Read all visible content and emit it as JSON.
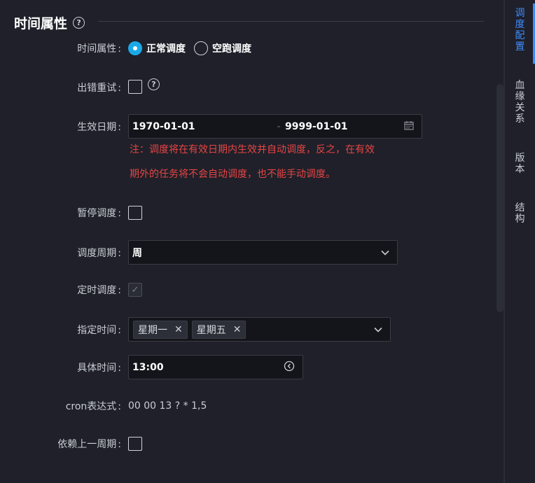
{
  "section": {
    "title": "时间属性",
    "help_glyph": "?"
  },
  "form": {
    "time_attr": {
      "label": "时间属性",
      "colon": ":",
      "options": [
        {
          "label": "正常调度",
          "checked": true
        },
        {
          "label": "空跑调度",
          "checked": false
        }
      ]
    },
    "retry": {
      "label": "出错重试",
      "colon": ":",
      "checked": false,
      "help_glyph": "?"
    },
    "effective_date": {
      "label": "生效日期",
      "colon": ":",
      "start": "1970-01-01",
      "separator": "-",
      "end": "9999-01-01"
    },
    "note": {
      "line1": "注：调度将在有效日期内生效并自动调度，反之，在有效",
      "line2": "期外的任务将不会自动调度，也不能手动调度。"
    },
    "pause": {
      "label": "暂停调度",
      "colon": ":",
      "checked": false
    },
    "cycle": {
      "label": "调度周期",
      "colon": ":",
      "value": "周"
    },
    "timed": {
      "label": "定时调度",
      "colon": ":",
      "checked": true,
      "check_glyph": "✓"
    },
    "specified_time": {
      "label": "指定时间",
      "colon": ":",
      "tags": [
        {
          "label": "星期一",
          "remove_glyph": "✕"
        },
        {
          "label": "星期五",
          "remove_glyph": "✕"
        }
      ]
    },
    "exact_time": {
      "label": "具体时间",
      "colon": ":",
      "value": "13:00"
    },
    "cron": {
      "label": "cron表达式",
      "colon": ":",
      "value": "00 00 13 ? * 1,5"
    },
    "depends_prev": {
      "label": "依赖上一周期",
      "colon": ":",
      "checked": false
    }
  },
  "sidebar": {
    "items": [
      {
        "chars": [
          "调",
          "度",
          "配",
          "置"
        ],
        "active": true
      },
      {
        "chars": [
          "血",
          "缘",
          "关",
          "系"
        ],
        "active": false
      },
      {
        "chars": [
          "版",
          "本"
        ],
        "active": false
      },
      {
        "chars": [
          "结",
          "构"
        ],
        "active": false
      }
    ]
  },
  "colors": {
    "accent": "#1aa9e8",
    "warning": "#e54545",
    "active_tab": "#3f8cff"
  }
}
